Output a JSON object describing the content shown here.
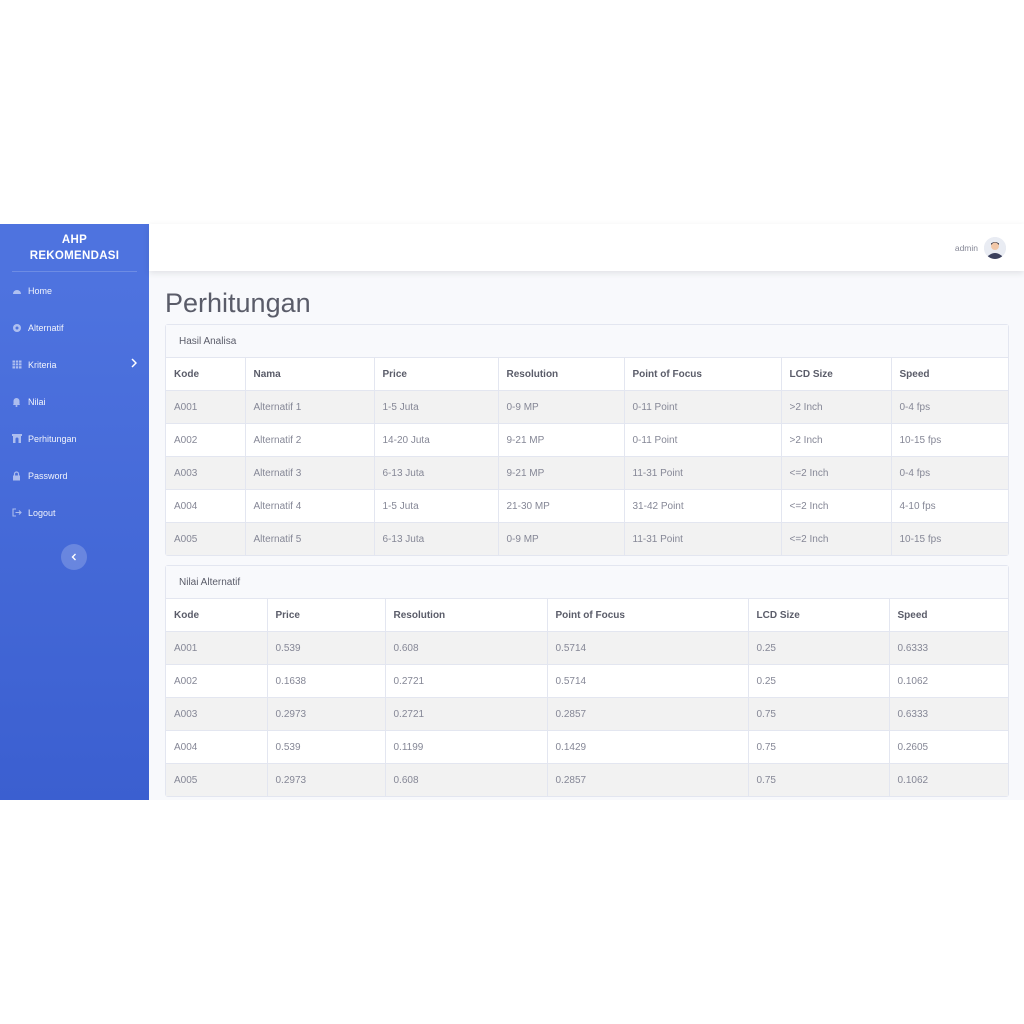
{
  "sidebar": {
    "brand_line1": "AHP",
    "brand_line2": "REKOMENDASI",
    "items": [
      {
        "label": "Home"
      },
      {
        "label": "Alternatif"
      },
      {
        "label": "Kriteria"
      },
      {
        "label": "Nilai"
      },
      {
        "label": "Perhitungan"
      },
      {
        "label": "Password"
      },
      {
        "label": "Logout"
      }
    ]
  },
  "topbar": {
    "user_name": "admin"
  },
  "page": {
    "title": "Perhitungan"
  },
  "hasil": {
    "header": "Hasil Analisa",
    "columns": [
      "Kode",
      "Nama",
      "Price",
      "Resolution",
      "Point of Focus",
      "LCD Size",
      "Speed"
    ],
    "rows": [
      [
        "A001",
        "Alternatif 1",
        "1-5 Juta",
        "0-9 MP",
        "0-11 Point",
        ">2 Inch",
        "0-4 fps"
      ],
      [
        "A002",
        "Alternatif 2",
        "14-20 Juta",
        "9-21 MP",
        "0-11 Point",
        ">2 Inch",
        "10-15 fps"
      ],
      [
        "A003",
        "Alternatif 3",
        "6-13 Juta",
        "9-21 MP",
        "11-31 Point",
        "<=2 Inch",
        "0-4 fps"
      ],
      [
        "A004",
        "Alternatif 4",
        "1-5 Juta",
        "21-30 MP",
        "31-42 Point",
        "<=2 Inch",
        "4-10 fps"
      ],
      [
        "A005",
        "Alternatif 5",
        "6-13 Juta",
        "0-9 MP",
        "11-31 Point",
        "<=2 Inch",
        "10-15 fps"
      ]
    ]
  },
  "nilai": {
    "header": "Nilai Alternatif",
    "columns": [
      "Kode",
      "Price",
      "Resolution",
      "Point of Focus",
      "LCD Size",
      "Speed"
    ],
    "rows": [
      [
        "A001",
        "0.539",
        "0.608",
        "0.5714",
        "0.25",
        "0.6333"
      ],
      [
        "A002",
        "0.1638",
        "0.2721",
        "0.5714",
        "0.25",
        "0.1062"
      ],
      [
        "A003",
        "0.2973",
        "0.2721",
        "0.2857",
        "0.75",
        "0.6333"
      ],
      [
        "A004",
        "0.539",
        "0.1199",
        "0.1429",
        "0.75",
        "0.2605"
      ],
      [
        "A005",
        "0.2973",
        "0.608",
        "0.2857",
        "0.75",
        "0.1062"
      ]
    ]
  },
  "icons": {
    "home": "tachometer-icon",
    "alternatif": "cog-icon",
    "kriteria": "table-icon",
    "nilai": "bell-icon",
    "perhitungan": "archway-icon",
    "password": "lock-icon",
    "logout": "sign-out-icon"
  },
  "colors": {
    "sidebar": "#4e73df",
    "text_muted": "#858796",
    "text_dark": "#5a5c69"
  }
}
